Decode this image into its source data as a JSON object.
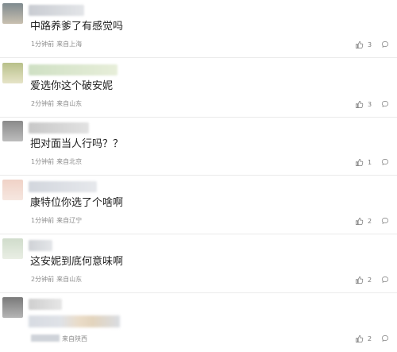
{
  "comments": [
    {
      "text": "中路养爹了有感觉吗",
      "time": "1分钟前",
      "from": "来自上海",
      "likes": "3",
      "avatar_colors": [
        "#7f8b8f",
        "#c9c0b0"
      ],
      "username_colors": [
        "#c9ccd2",
        "#e3e5e8"
      ],
      "username_width": 70
    },
    {
      "text": "爱选你这个破安妮",
      "time": "2分钟前",
      "from": "来自山东",
      "likes": "3",
      "avatar_colors": [
        "#b8c08a",
        "#e6e4c8"
      ],
      "username_colors": [
        "#cfe0c4",
        "#e7eed9"
      ],
      "username_width": 112
    },
    {
      "text": "把对面当人行吗？？",
      "time": "1分钟前",
      "from": "来自北京",
      "likes": "1",
      "avatar_colors": [
        "#8a8a8a",
        "#bdbdbd"
      ],
      "username_colors": [
        "#c8c8c8",
        "#e2e2e2"
      ],
      "username_width": 76
    },
    {
      "text": "康特位你选了个啥啊",
      "time": "1分钟前",
      "from": "来自辽宁",
      "likes": "2",
      "avatar_colors": [
        "#f0d2c6",
        "#f6e7e0"
      ],
      "username_colors": [
        "#d2d6dd",
        "#e6e8ec"
      ],
      "username_width": 86
    },
    {
      "text": "这安妮到底何意味啊",
      "time": "2分钟前",
      "from": "来自山东",
      "likes": "2",
      "avatar_colors": [
        "#d0dccb",
        "#e9eee4"
      ],
      "username_colors": [
        "#cfd2d6",
        "#e4e6e9"
      ],
      "username_width": 30
    },
    {
      "text": "",
      "time": "",
      "from": "来自陕西",
      "likes": "2",
      "avatar_colors": [
        "#7a7a7a",
        "#b5b5b5"
      ],
      "username_colors": [
        "#cfcfcf",
        "#e6e6e6"
      ],
      "username_width": 42
    }
  ],
  "icons": {
    "like": "thumbs-up-icon",
    "reply": "reply-icon"
  },
  "colors": {
    "text": "#1f1f1f",
    "meta": "#8c8c8c",
    "divider": "#ebebeb"
  }
}
